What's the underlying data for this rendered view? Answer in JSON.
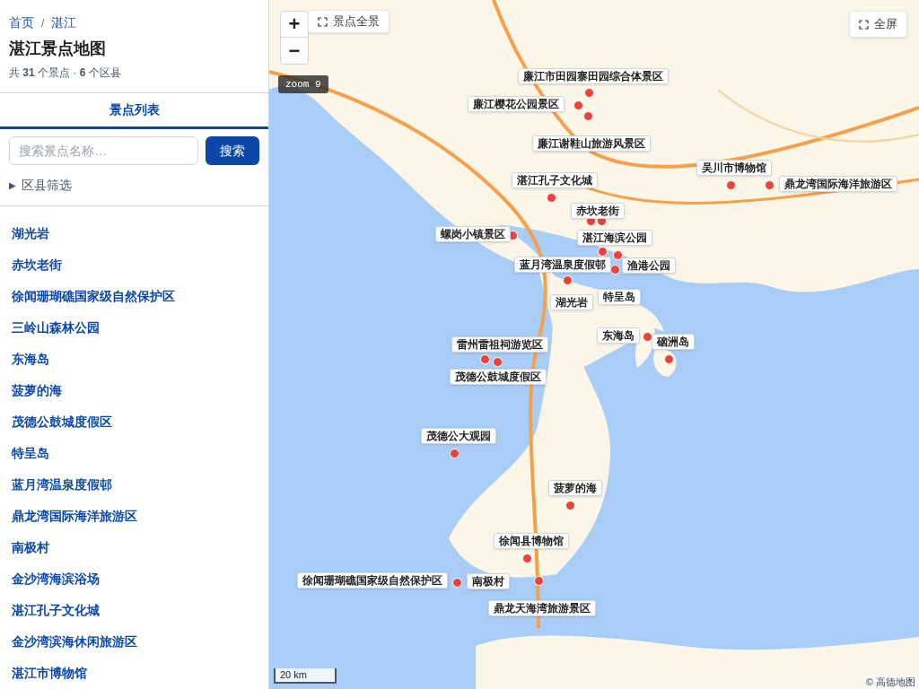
{
  "breadcrumb": [
    {
      "label": "首页"
    },
    {
      "label": "湛江"
    }
  ],
  "breadcrumb_separator": "/",
  "title": "湛江景点地图",
  "stats": "共 **31** 个景点 · **6** 个区县",
  "tabs": [
    {
      "label": "景点列表",
      "selected": true
    }
  ],
  "search": {
    "placeholder": "搜索景点名称…",
    "button": "搜索"
  },
  "filter": {
    "icon": "▶",
    "label": "区县筛选",
    "expanded": false
  },
  "spots": [
    "湖光岩",
    "赤坎老街",
    "徐闻珊瑚礁国家级自然保护区",
    "三岭山森林公园",
    "东海岛",
    "菠萝的海",
    "茂德公鼓城度假区",
    "特呈岛",
    "蓝月湾温泉度假邨",
    "鼎龙湾国际海洋旅游区",
    "南极村",
    "金沙湾海滨浴场",
    "湛江孔子文化城",
    "金沙湾滨海休闲旅游区",
    "湛江市博物馆"
  ],
  "map": {
    "zoom_in": "+",
    "zoom_out": "−",
    "overview_button": "景点全景",
    "fullscreen_button": "全屏",
    "zoom_badge": "zoom 9",
    "scale": "20 km",
    "attribution": "© 高德地图",
    "markers": [
      {
        "label": "廉江市田园寨田园综合体景区"
      },
      {
        "label": "廉江樱花公园景区"
      },
      {
        "label": "廉江谢鞋山旅游风景区"
      },
      {
        "label": "湛江孔子文化城"
      },
      {
        "label": "赤坎老街"
      },
      {
        "label": "螺岗小镇景区"
      },
      {
        "label": "湛江海滨公园"
      },
      {
        "label": "蓝月湾温泉度假邨"
      },
      {
        "label": "渔港公园"
      },
      {
        "label": "湖光岩"
      },
      {
        "label": "特呈岛"
      },
      {
        "label": "东海岛"
      },
      {
        "label": "硇洲岛"
      },
      {
        "label": "雷州雷祖祠游览区"
      },
      {
        "label": "茂德公鼓城度假区"
      },
      {
        "label": "吴川市博物馆"
      },
      {
        "label": "鼎龙湾国际海洋旅游区"
      },
      {
        "label": "茂德公大观园"
      },
      {
        "label": "菠萝的海"
      },
      {
        "label": "徐闻县博物馆"
      },
      {
        "label": "徐闻珊瑚礁国家级自然保护区"
      },
      {
        "label": "南极村"
      },
      {
        "label": "鼎龙天海湾旅游景区"
      }
    ]
  }
}
